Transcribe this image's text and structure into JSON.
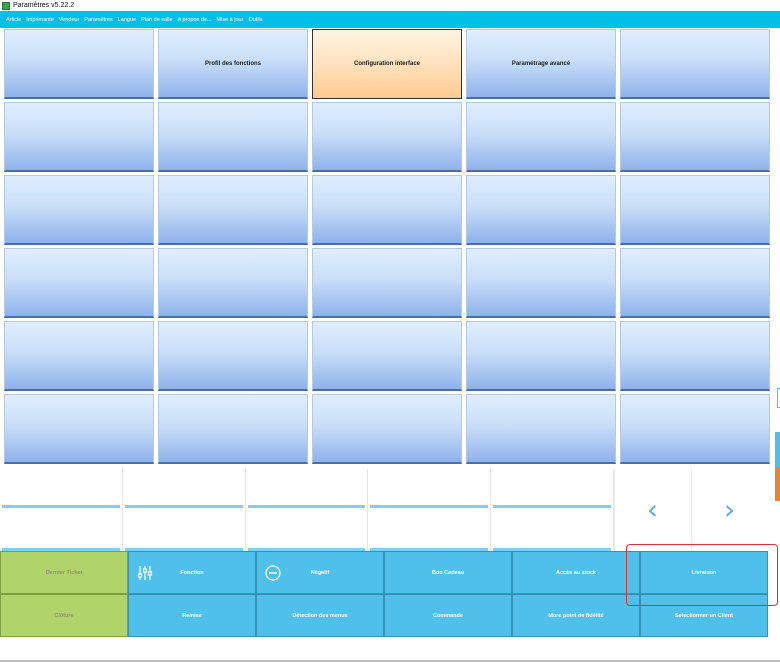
{
  "window": {
    "title": "Paramètres v5.22.2"
  },
  "menu": [
    "Article",
    "Imprimante",
    "Vendeur",
    "Paramètres",
    "Langue",
    "Plan de salle",
    "A propos de...",
    "Mise à jour",
    "Outils"
  ],
  "grid": {
    "cells": [
      {
        "label": ""
      },
      {
        "label": "Profil des fonctions"
      },
      {
        "label": "Configuration interface",
        "active": true
      },
      {
        "label": "Paramétrage avancé"
      },
      {
        "label": ""
      },
      {
        "label": ""
      },
      {
        "label": ""
      },
      {
        "label": ""
      },
      {
        "label": ""
      },
      {
        "label": ""
      },
      {
        "label": ""
      },
      {
        "label": ""
      },
      {
        "label": ""
      },
      {
        "label": ""
      },
      {
        "label": ""
      },
      {
        "label": ""
      },
      {
        "label": ""
      },
      {
        "label": ""
      },
      {
        "label": ""
      },
      {
        "label": ""
      },
      {
        "label": ""
      },
      {
        "label": ""
      },
      {
        "label": ""
      },
      {
        "label": ""
      },
      {
        "label": ""
      },
      {
        "label": ""
      },
      {
        "label": ""
      },
      {
        "label": ""
      },
      {
        "label": ""
      },
      {
        "label": ""
      }
    ]
  },
  "nav": {
    "prev": "‹",
    "next": "›"
  },
  "function_bar": {
    "row1": [
      "Dernier Ticket",
      "Fonction",
      "Négatif",
      "Bon Cadeau",
      "Accès au stock",
      "Livraison"
    ],
    "row2": [
      "Clôture",
      "Remise",
      "Détection des menus",
      "Commande",
      "More point de fidélité",
      "Selectionner un Client"
    ]
  },
  "colors": {
    "menubar": "#00c0e8",
    "button": "#4ec0e9",
    "green_button": "#b0d36a",
    "highlight": "#d9323a",
    "active_cell": "#ffc98f"
  },
  "icons": {
    "fonction": "sliders-icon",
    "negatif": "minus-circle-icon"
  }
}
